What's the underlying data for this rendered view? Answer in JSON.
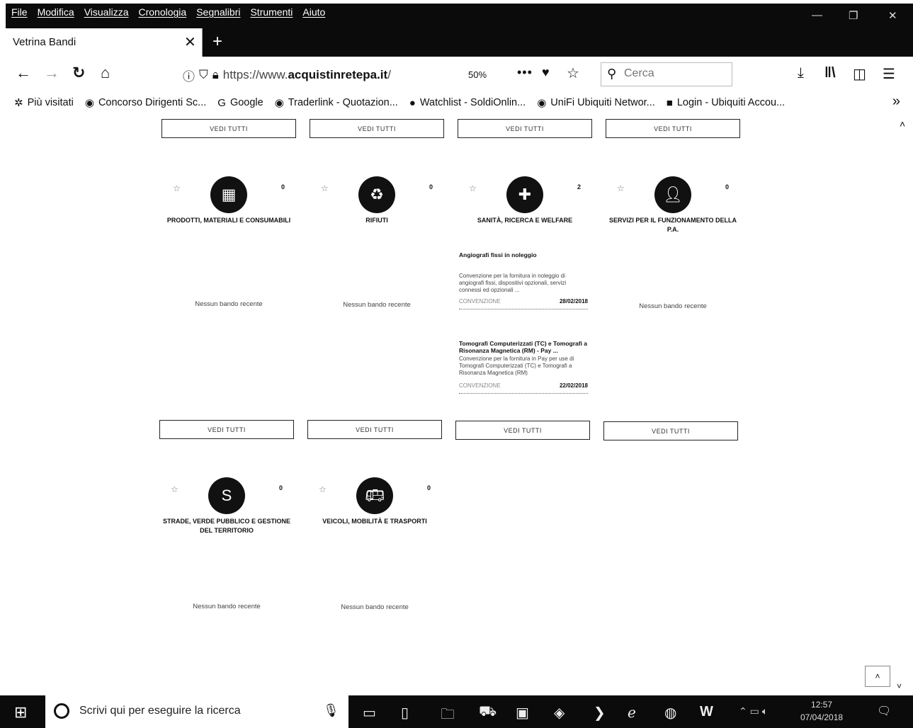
{
  "menu": [
    "File",
    "Modifica",
    "Visualizza",
    "Cronologia",
    "Segnalibri",
    "Strumenti",
    "Aiuto"
  ],
  "tab": {
    "title": "Vetrina Bandi",
    "close": "✕",
    "new": "+"
  },
  "nav": {
    "back": "←",
    "forward": "→",
    "reload": "↻",
    "home": "⌂",
    "url_prefix": "https://www.",
    "url_domain": "acquistinretepa.it",
    "url_suffix": "/",
    "zoom": "50%",
    "search_placeholder": "Cerca"
  },
  "bookmarks": [
    {
      "label": "Più visitati",
      "icon": "gear-icon"
    },
    {
      "label": "Concorso Dirigenti Sc...",
      "icon": "globe-icon"
    },
    {
      "label": "Google",
      "icon": "google-icon"
    },
    {
      "label": "Traderlink - Quotazion...",
      "icon": "globe-icon"
    },
    {
      "label": "Watchlist - SoldiOnlin...",
      "icon": "circle-icon"
    },
    {
      "label": "UniFi Ubiquiti Networ...",
      "icon": "globe-icon"
    },
    {
      "label": "Login - Ubiquiti Accou...",
      "icon": "square-icon"
    }
  ],
  "vedi_label": "VEDI TUTTI",
  "no_recent": "Nessun bando recente",
  "categories": [
    {
      "title": "PRODOTTI, MATERIALI E CONSUMABILI",
      "count": "0",
      "icon": "products-icon"
    },
    {
      "title": "RIFIUTI",
      "count": "0",
      "icon": "waste-icon"
    },
    {
      "title": "SANITÀ, RICERCA E WELFARE",
      "count": "2",
      "icon": "health-icon"
    },
    {
      "title": "SERVIZI PER IL FUNZIONAMENTO DELLA P.A.",
      "count": "0",
      "icon": "services-icon"
    },
    {
      "title": "STRADE, VERDE PUBBLICO E GESTIONE DEL TERRITORIO",
      "count": "0",
      "icon": "roads-icon"
    },
    {
      "title": "VEICOLI, MOBILITÀ E TRASPORTI",
      "count": "0",
      "icon": "vehicles-icon"
    }
  ],
  "news": [
    {
      "title": "Angiografi fissi in noleggio",
      "desc": "Convenzione per la fornitura in noleggio di angiografi fissi, dispositivi opzionali, servizi connessi ed opzionali ...",
      "code": "CONVENZIONE",
      "date": "28/02/2018"
    },
    {
      "title": "Tomografi Computerizzati (TC) e Tomografi a Risonanza Magnetica (RM) - Pay ...",
      "desc": "Convenzione per la fornitura in Pay per use di Tomografi Computerizzati (TC) e Tomografi a Risonanza Magnetica (RM)",
      "code": "CONVENZIONE",
      "date": "22/02/2018"
    }
  ],
  "taskbar": {
    "search": "Scrivi qui per eseguire la ricerca",
    "time": "12:57",
    "date": "07/04/2018"
  }
}
